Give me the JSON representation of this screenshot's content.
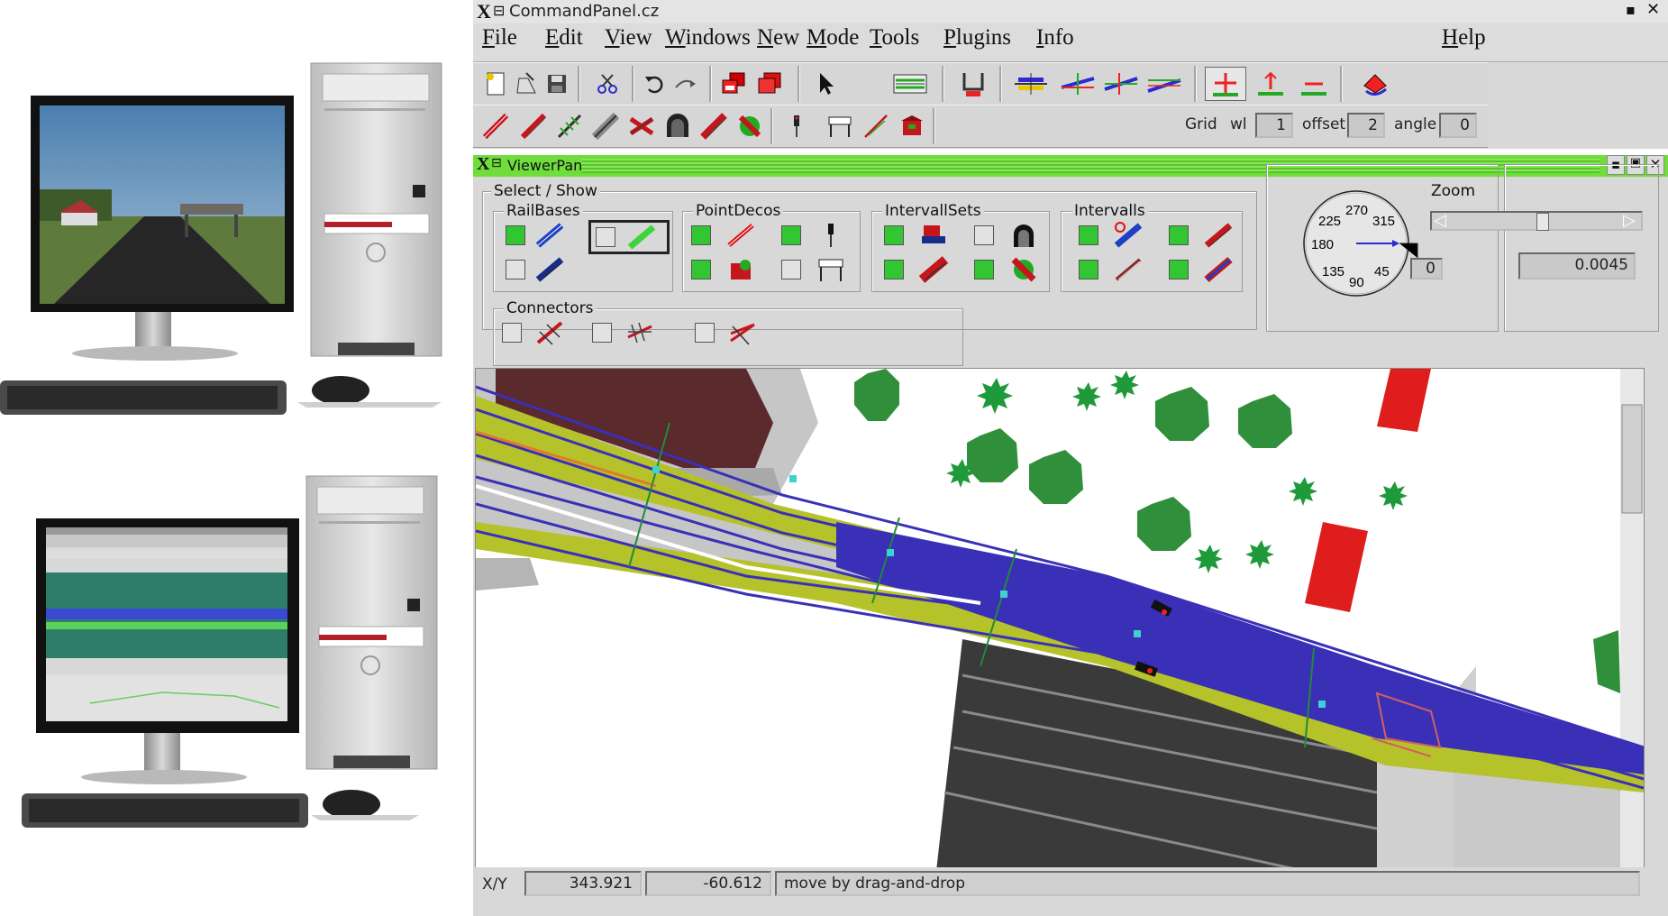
{
  "command_panel": {
    "title": "CommandPanel.cz",
    "menus": [
      "File",
      "Edit",
      "View",
      "Windows",
      "New",
      "Mode",
      "Tools",
      "Plugins",
      "Info"
    ],
    "help": "Help",
    "grid": {
      "label": "Grid",
      "wl_label": "wl",
      "wl_value": "1",
      "offset_label": "offset",
      "offset_value": "2",
      "angle_label": "angle",
      "angle_value": "0"
    }
  },
  "viewer_panel": {
    "title": "ViewerPanel",
    "select_show_label": "Select / Show",
    "groups": {
      "rail_bases": "RailBases",
      "point_decos": "PointDecos",
      "intervall_sets": "IntervallSets",
      "intervalls": "Intervalls",
      "connectors": "Connectors"
    },
    "compass": {
      "labels": [
        "270",
        "225",
        "315",
        "180",
        "135",
        "90",
        "45"
      ],
      "value": "0"
    },
    "zoom": {
      "label": "Zoom",
      "value": "0.0045",
      "position": 0.5
    }
  },
  "status_bar": {
    "xy_label": "X/Y",
    "x_value": "343.921",
    "y_value": "-60.612",
    "message": "move by drag-and-drop"
  },
  "colors": {
    "check_on": "#33c633",
    "track_blue": "#3a30b8",
    "track_yellow": "#b6c22a",
    "tree_green": "#2f8f3a",
    "car_red": "#e01d1d",
    "title_green": "#6fdd3c"
  }
}
